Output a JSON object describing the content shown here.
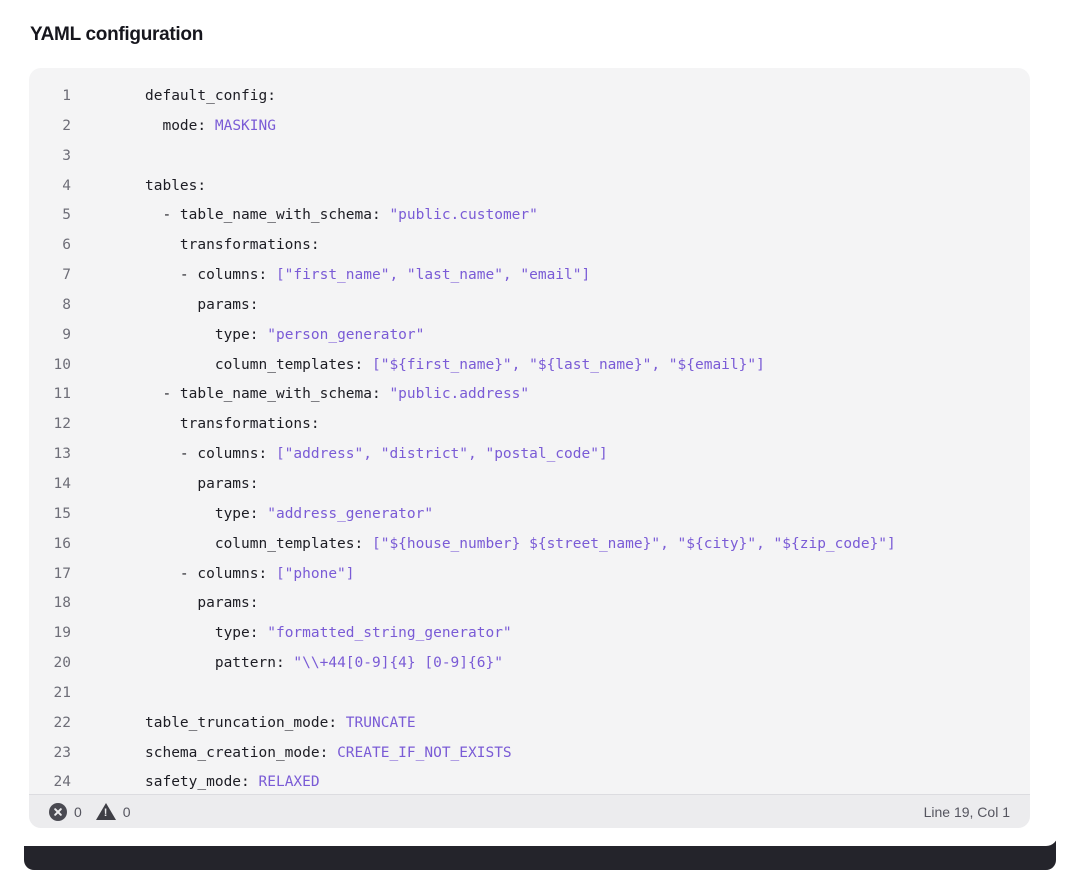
{
  "section": {
    "title": "YAML configuration"
  },
  "editor": {
    "lines": [
      {
        "n": "1",
        "indent": "",
        "key": "default_config:",
        "value": ""
      },
      {
        "n": "2",
        "indent": "  ",
        "key": "mode: ",
        "value": "MASKING"
      },
      {
        "n": "3",
        "indent": "",
        "key": "",
        "value": ""
      },
      {
        "n": "4",
        "indent": "",
        "key": "tables:",
        "value": ""
      },
      {
        "n": "5",
        "indent": "  ",
        "key": "- table_name_with_schema: ",
        "value": "\"public.customer\""
      },
      {
        "n": "6",
        "indent": "    ",
        "key": "transformations:",
        "value": ""
      },
      {
        "n": "7",
        "indent": "    ",
        "key": "- columns: ",
        "value": "[\"first_name\", \"last_name\", \"email\"]"
      },
      {
        "n": "8",
        "indent": "      ",
        "key": "params:",
        "value": ""
      },
      {
        "n": "9",
        "indent": "        ",
        "key": "type: ",
        "value": "\"person_generator\""
      },
      {
        "n": "10",
        "indent": "        ",
        "key": "column_templates: ",
        "value": "[\"${first_name}\", \"${last_name}\", \"${email}\"]"
      },
      {
        "n": "11",
        "indent": "  ",
        "key": "- table_name_with_schema: ",
        "value": "\"public.address\""
      },
      {
        "n": "12",
        "indent": "    ",
        "key": "transformations:",
        "value": ""
      },
      {
        "n": "13",
        "indent": "    ",
        "key": "- columns: ",
        "value": "[\"address\", \"district\", \"postal_code\"]"
      },
      {
        "n": "14",
        "indent": "      ",
        "key": "params:",
        "value": ""
      },
      {
        "n": "15",
        "indent": "        ",
        "key": "type: ",
        "value": "\"address_generator\""
      },
      {
        "n": "16",
        "indent": "        ",
        "key": "column_templates: ",
        "value": "[\"${house_number} ${street_name}\", \"${city}\", \"${zip_code}\"]"
      },
      {
        "n": "17",
        "indent": "    ",
        "key": "- columns: ",
        "value": "[\"phone\"]"
      },
      {
        "n": "18",
        "indent": "      ",
        "key": "params:",
        "value": ""
      },
      {
        "n": "19",
        "indent": "        ",
        "key": "type: ",
        "value": "\"formatted_string_generator\""
      },
      {
        "n": "20",
        "indent": "        ",
        "key": "pattern: ",
        "value": "\"\\\\+44[0-9]{4} [0-9]{6}\""
      },
      {
        "n": "21",
        "indent": "",
        "key": "",
        "value": ""
      },
      {
        "n": "22",
        "indent": "",
        "key": "table_truncation_mode: ",
        "value": "TRUNCATE"
      },
      {
        "n": "23",
        "indent": "",
        "key": "schema_creation_mode: ",
        "value": "CREATE_IF_NOT_EXISTS"
      },
      {
        "n": "24",
        "indent": "",
        "key": "safety_mode: ",
        "value": "RELAXED"
      }
    ]
  },
  "status": {
    "errors": "0",
    "warnings": "0",
    "cursor": "Line 19, Col 1"
  }
}
